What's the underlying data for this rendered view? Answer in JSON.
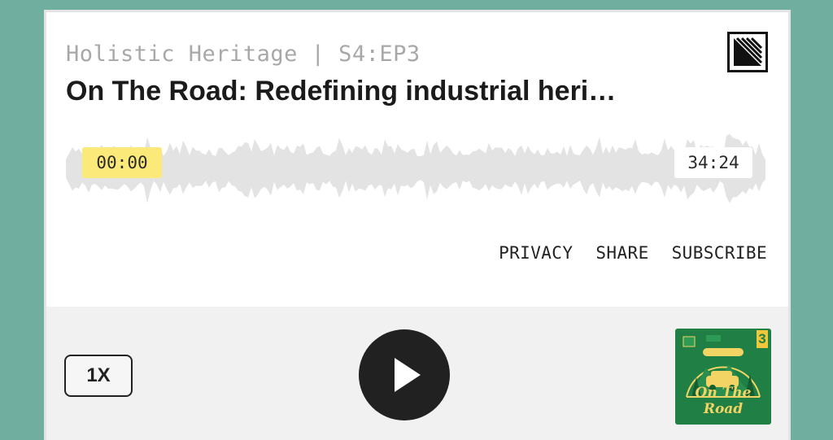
{
  "player": {
    "show_line": "Holistic Heritage | S4:EP3",
    "episode_title": "On The Road: Redefining industrial heri…",
    "current_time": "00:00",
    "total_time": "34:24",
    "links": {
      "privacy": "PRIVACY",
      "share": "SHARE",
      "subscribe": "SUBSCRIBE"
    },
    "speed": "1X",
    "progress": 0.0,
    "cover_art": {
      "icon": "podcast-cover-art",
      "number": "3",
      "title": "On The Road"
    },
    "brand_icon": "podcast-platform-logo"
  },
  "colors": {
    "page_background": "#70ae9f",
    "time_highlight": "#fbe97a",
    "play_button": "#212121",
    "waveform": "#e3e3e3",
    "cover_green": "#1f7f44",
    "cover_yellow": "#f1d463"
  }
}
